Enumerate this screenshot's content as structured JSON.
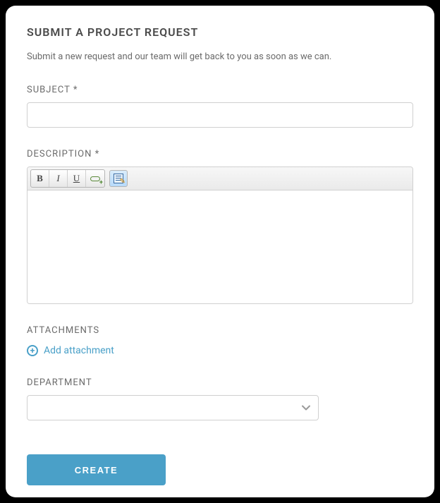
{
  "title": "SUBMIT A PROJECT REQUEST",
  "intro": "Submit a new request and our team will get back to you as soon as we can.",
  "subject": {
    "label": "SUBJECT *",
    "value": ""
  },
  "description": {
    "label": "DESCRIPTION *",
    "value": ""
  },
  "attachments": {
    "label": "ATTACHMENTS",
    "add_label": "Add attachment"
  },
  "department": {
    "label": "DEPARTMENT",
    "value": ""
  },
  "submit_label": "CREATE"
}
